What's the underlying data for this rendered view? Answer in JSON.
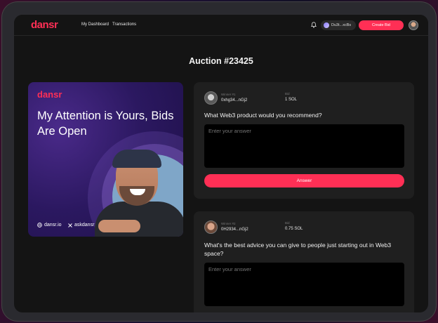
{
  "nav": {
    "logo": "dansr",
    "links": [
      "My Dashboard",
      "Transactions"
    ],
    "wallet": "Du3t...xcBs",
    "create_label": "Create Bid"
  },
  "page": {
    "title": "Auction #23425"
  },
  "banner": {
    "logo": "dansr",
    "headline": "My Attention is Yours, Bids Are Open",
    "site": "dansr.io",
    "handle": "askdansr"
  },
  "bids": [
    {
      "winner_label": "Winner #1",
      "winner": "0xhg34...nGj2",
      "bid_label": "Bid",
      "bid": "1 SOL",
      "question": "What Web3 product would you recommend?",
      "placeholder": "Enter your answer",
      "button": "Answer"
    },
    {
      "winner_label": "Winner #2",
      "winner": "0H2934...nGj2",
      "bid_label": "Bid",
      "bid": "0.75 SOL",
      "question": "What's the best advice you can give to people just starting out in Web3 space?",
      "placeholder": "Enter your answer"
    }
  ],
  "colors": {
    "accent": "#ff2f55",
    "background": "#141414",
    "card": "#1f1f1f"
  }
}
